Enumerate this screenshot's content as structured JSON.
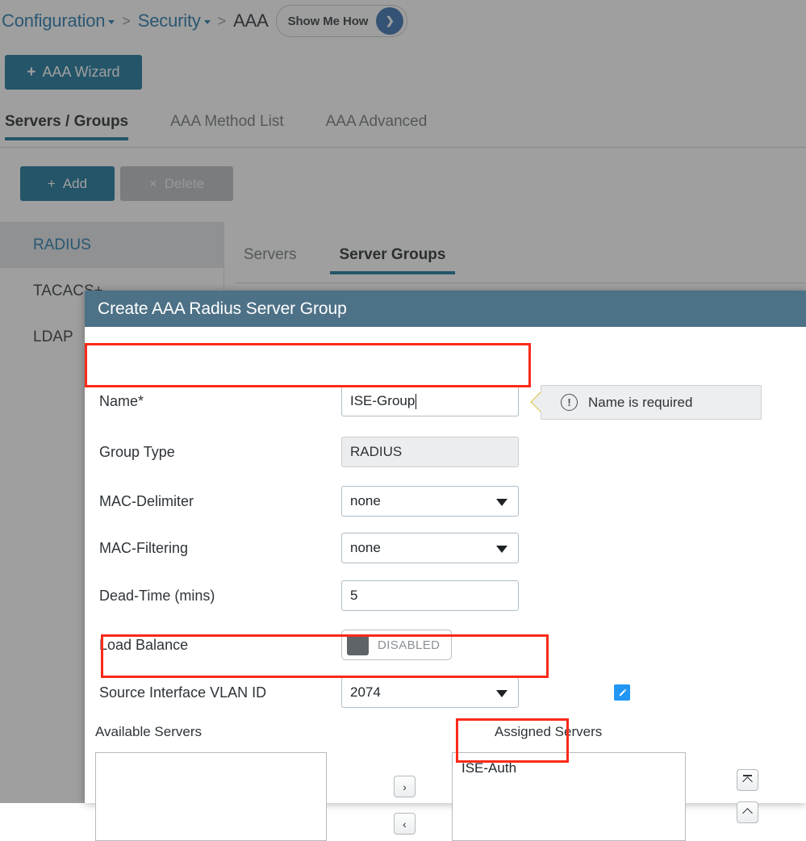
{
  "breadcrumb": {
    "items": [
      {
        "label": "Configuration",
        "has_caret": true,
        "current": false
      },
      {
        "label": "Security",
        "has_caret": true,
        "current": false
      },
      {
        "label": "AAA",
        "has_caret": false,
        "current": true
      }
    ],
    "separator": ">",
    "show_me_how": {
      "label": "Show Me How",
      "arrow_glyph": "❯"
    }
  },
  "wizard_button": {
    "label": "AAA Wizard",
    "plus": "+"
  },
  "main_tabs": [
    {
      "label": "Servers / Groups",
      "active": true
    },
    {
      "label": "AAA Method List",
      "active": false
    },
    {
      "label": "AAA Advanced",
      "active": false
    }
  ],
  "toolbar": {
    "add_label": "Add",
    "add_icon": "+",
    "delete_label": "Delete",
    "delete_icon": "×"
  },
  "sidebar": {
    "items": [
      {
        "label": "RADIUS",
        "active": true
      },
      {
        "label": "TACACS+",
        "active": false
      },
      {
        "label": "LDAP",
        "active": false
      }
    ]
  },
  "sub_tabs": [
    {
      "label": "Servers",
      "active": false
    },
    {
      "label": "Server Groups",
      "active": true
    }
  ],
  "modal": {
    "title": "Create AAA Radius Server Group",
    "fields": {
      "name": {
        "label": "Name*",
        "value": "ISE-Group",
        "placeholder": ""
      },
      "group_type": {
        "label": "Group Type",
        "value": "RADIUS"
      },
      "mac_delimiter": {
        "label": "MAC-Delimiter",
        "value": "none"
      },
      "mac_filtering": {
        "label": "MAC-Filtering",
        "value": "none"
      },
      "dead_time": {
        "label": "Dead-Time (mins)",
        "value": "5"
      },
      "load_balance": {
        "label": "Load Balance",
        "state": "DISABLED"
      },
      "source_vlan": {
        "label": "Source Interface VLAN ID",
        "value": "2074",
        "edit_icon": "✎"
      }
    },
    "tooltip": {
      "text": "Name is required",
      "icon": "!"
    },
    "transfer": {
      "available_label": "Available Servers",
      "assigned_label": "Assigned Servers",
      "available_items": [],
      "assigned_items": [
        "ISE-Auth"
      ],
      "move_right": "›",
      "move_left": "‹"
    }
  },
  "colors": {
    "accent_blue": "#0f6e96",
    "modal_header": "#4d7186",
    "link_blue": "#1a73a7",
    "annotation_red": "#fb2a18",
    "edit_icon_blue": "#2196f3"
  }
}
